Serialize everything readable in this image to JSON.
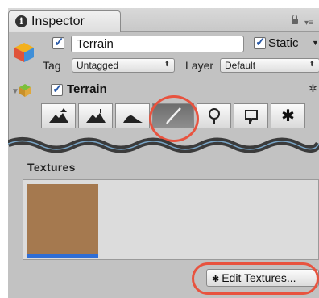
{
  "tab": {
    "title": "Inspector",
    "info_glyph": "i"
  },
  "object": {
    "name": "Terrain",
    "active": true,
    "static_label": "Static",
    "static_checked": true,
    "tag_label": "Tag",
    "tag_value": "Untagged",
    "layer_label": "Layer",
    "layer_value": "Default"
  },
  "component": {
    "title": "Terrain",
    "enabled": true,
    "tools": [
      {
        "icon": "raise-lower-terrain-icon",
        "active": false
      },
      {
        "icon": "paint-height-icon",
        "active": false
      },
      {
        "icon": "smooth-height-icon",
        "active": false
      },
      {
        "icon": "paint-texture-icon",
        "active": true
      },
      {
        "icon": "place-trees-icon",
        "active": false
      },
      {
        "icon": "paint-details-icon",
        "active": false
      },
      {
        "icon": "terrain-settings-icon",
        "active": false
      }
    ]
  },
  "textures": {
    "section_label": "Textures",
    "items": [
      {
        "color": "#a5794f",
        "selected": true
      }
    ]
  },
  "edit_button": {
    "label": "Edit Textures..."
  },
  "colors": {
    "highlight": "#e8533f",
    "selection": "#2f6ed6"
  }
}
